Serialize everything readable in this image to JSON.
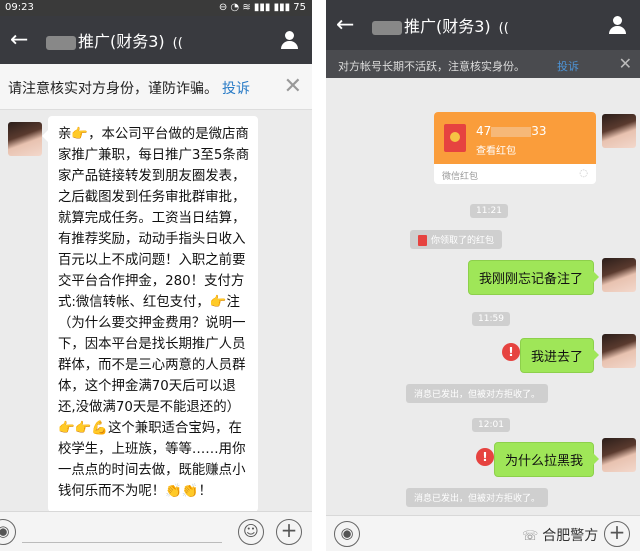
{
  "left": {
    "statusbar": {
      "time": "09:23",
      "indicators": "⊖ ◔ ≋ ▮▮▮ ▮▮▮ 75"
    },
    "header": {
      "back": "←",
      "title": "推广(财务3)",
      "ear": "(("
    },
    "warning": {
      "text": "请注意核实对方身份，谨防诈骗。",
      "link": "投诉",
      "close": "✕"
    },
    "message": "亲👉，本公司平台做的是微店商家推广兼职，每日推广3至5条商家产品链接转发到朋友圈发表，之后截图发到任务审批群审批，就算完成任务。工资当日结算，有推荐奖励，动动手指头日收入百元以上不成问题！入职之前要交平台合作押金，280！支付方式:微信转帐、红包支付，👉注（为什么要交押金费用？说明一下，因本平台是找长期推广人员群体，而不是三心两意的人员群体，这个押金满70天后可以退还,没做满70天是不能退还的）👉👉💪这个兼职适合宝妈，在校学生，上班族，等等……用你一点点的时间去做，既能赚点小钱何乐而不为呢！👏👏！",
    "input": {
      "voice": "◉",
      "emoji": "☺",
      "plus": "+"
    }
  },
  "right": {
    "header": {
      "back": "←",
      "title": "推广(财务3)",
      "ear": "(("
    },
    "notice": {
      "text": "对方帐号长期不活跃，注意核实身份。",
      "link": "投诉",
      "close": "✕"
    },
    "redpacket": {
      "amount_prefix": "47",
      "amount_suffix": "33",
      "status": "查看红包",
      "footer": "微信红包",
      "mark": "◌"
    },
    "time1": "11:21",
    "system1": "你领取了的红包",
    "msg1": "我刚刚忘记备注了",
    "time2": "11:59",
    "msg2": "我进去了",
    "rejected1": "消息已发出，但被对方拒收了。",
    "time3": "12:01",
    "msg3": "为什么拉黑我",
    "rejected2": "消息已发出，但被对方拒收了。",
    "error_mark": "!",
    "watermark": {
      "icon": "☏",
      "text": "合肥警方"
    },
    "input": {
      "voice": "◉",
      "plus": "+"
    }
  }
}
